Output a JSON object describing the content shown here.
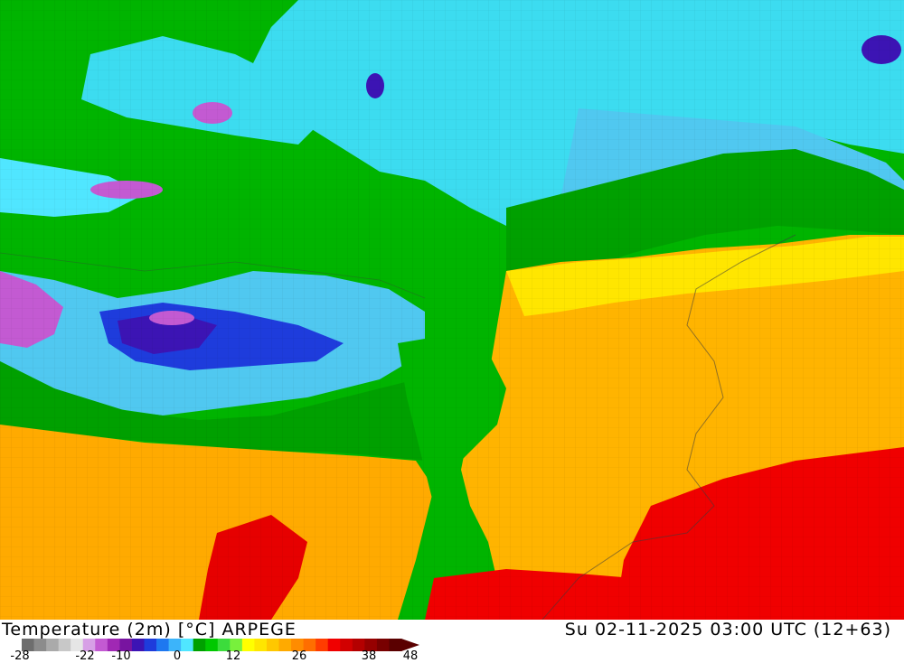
{
  "title": {
    "left": "Temperature (2m) [°C] ARPEGE",
    "right": "Su 02-11-2025 03:00 UTC (12+63)"
  },
  "legend": {
    "ticks": [
      "-28",
      "-22",
      "-10",
      "0",
      "12",
      "26",
      "38",
      "48"
    ],
    "colors": [
      "#6e6e6e",
      "#8c8c8c",
      "#aaaaaa",
      "#c8c8c8",
      "#e6e6e6",
      "#d7a0e6",
      "#c35ad2",
      "#a028b4",
      "#7814a0",
      "#3c14b4",
      "#1e3cdc",
      "#1e78f0",
      "#3cb4fa",
      "#50e6ff",
      "#00a000",
      "#00c800",
      "#3cdc3c",
      "#78f03c",
      "#ffff00",
      "#ffe600",
      "#ffc800",
      "#ffaa00",
      "#ff8c00",
      "#ff6e00",
      "#ff3c00",
      "#f00000",
      "#d20000",
      "#b40000",
      "#960000",
      "#780000",
      "#5a0000"
    ]
  },
  "map": {
    "palette": {
      "deep_cold": "#3c14b4",
      "cold_purple": "#a028b4",
      "cyan": "#3cdcf0",
      "light_blue": "#50c8f0",
      "dark_green": "#009600",
      "green": "#00b400",
      "light_green": "#3cd23c",
      "yellow": "#ffe600",
      "orange": "#ffb400",
      "dark_orange": "#ff8c00",
      "red": "#f00000",
      "dark_red": "#c80000"
    }
  }
}
